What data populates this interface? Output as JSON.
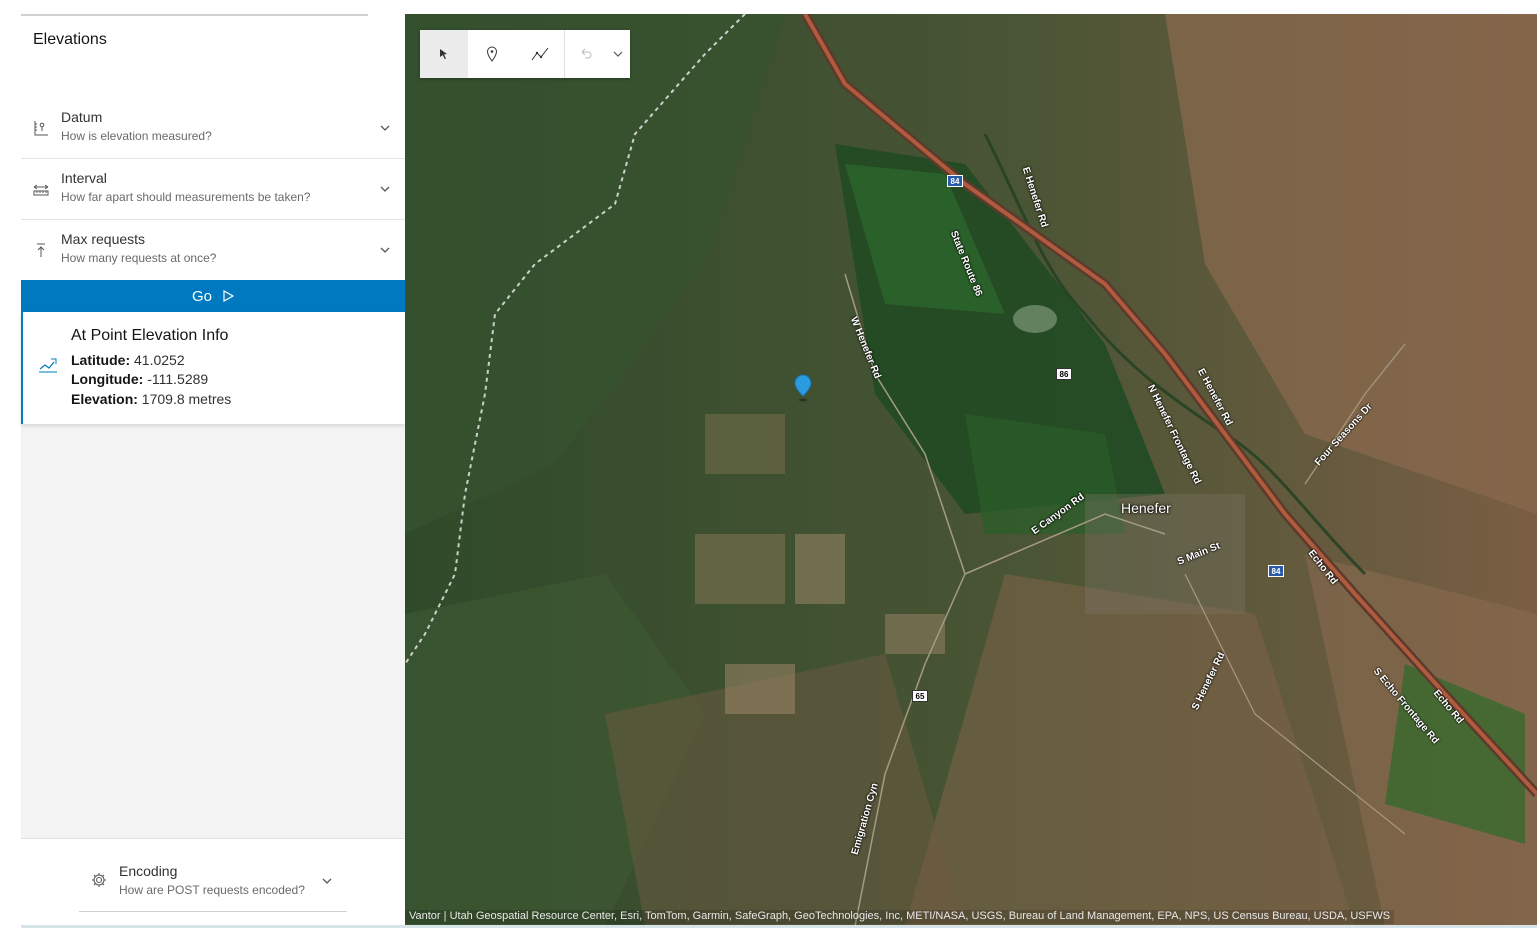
{
  "app": {
    "title": "Elevations"
  },
  "accordion": [
    {
      "title": "Datum",
      "subtitle": "How is elevation measured?",
      "icon": "datum-icon"
    },
    {
      "title": "Interval",
      "subtitle": "How far apart should measurements be taken?",
      "icon": "interval-icon"
    },
    {
      "title": "Max requests",
      "subtitle": "How many requests at once?",
      "icon": "max-requests-icon"
    }
  ],
  "go_button": {
    "label": "Go",
    "icon": "play-icon"
  },
  "result": {
    "title": "At Point Elevation Info",
    "latitude_label": "Latitude:",
    "latitude": "41.0252",
    "longitude_label": "Longitude:",
    "longitude": "-111.5289",
    "elevation_label": "Elevation:",
    "elevation": "1709.8 metres",
    "icon": "elevation-profile-icon"
  },
  "encoding": {
    "title": "Encoding",
    "subtitle": "How are POST requests encoded?",
    "icon": "gear-icon"
  },
  "toolbar": {
    "tools": [
      "cursor-icon",
      "point-icon",
      "polyline-icon",
      "undo-icon",
      "chevron-down-icon"
    ]
  },
  "map": {
    "attribution": "Vantor | Utah Geospatial Resource Center, Esri, TomTom, Garmin, SafeGraph, GeoTechnologies, Inc, METI/NASA, USGS, Bureau of Land Management, EPA, NPS, US Census Bureau, USDA, USFWS",
    "town": "Henefer",
    "labels": {
      "e_henefer_rd_1": "E Henefer Rd",
      "state_route_86": "State Route 86",
      "w_henefer_rd": "W Henefer Rd",
      "n_henefer_frontage_rd": "N Henefer Frontage Rd",
      "e_henefer_rd_2": "E Henefer Rd",
      "four_seasons_dr": "Four Seasons Dr",
      "e_canyon_rd": "E Canyon Rd",
      "s_main_st": "S Main St",
      "echo_rd_1": "Echo Rd",
      "s_henefer_rd": "S Henefer Rd",
      "s_echo_frontage_rd": "S Echo Frontage Rd",
      "echo_rd_2": "Echo Rd",
      "emigration_cyn": "Emigration Cyn"
    },
    "shields": {
      "i84_a": "84",
      "i84_b": "84",
      "sr86": "86",
      "sr65": "65"
    },
    "colors": {
      "accent": "#0079c1",
      "pin": "#2b9be0"
    }
  }
}
